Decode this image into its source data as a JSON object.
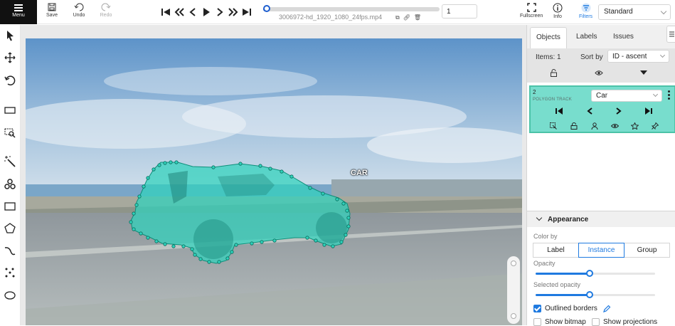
{
  "header": {
    "menu_label": "Menu",
    "save_label": "Save",
    "undo_label": "Undo",
    "redo_label": "Redo",
    "filename": "3006972-hd_1920_1080_24fps.mp4",
    "frame_number": "1",
    "playback_progress": 0.02,
    "fullscreen_label": "Fullscreen",
    "info_label": "Info",
    "filters_label": "Filters",
    "workspace_value": "Standard",
    "accent_color": "#1f7ae0"
  },
  "canvas": {
    "object_label_text": "CAR",
    "mask_color": "#2fd3bc"
  },
  "sidebar": {
    "tabs": [
      "Objects",
      "Labels",
      "Issues"
    ],
    "active_tab": "Objects",
    "items_count_text": "Items: 1",
    "sort_by_label": "Sort by",
    "sort_value": "ID - ascent",
    "object": {
      "id": "2",
      "type": "POLYGON TRACK",
      "label": "Car",
      "color": "#78ddcd"
    },
    "appearance": {
      "title": "Appearance",
      "color_by_label": "Color by",
      "color_by_options": [
        "Label",
        "Instance",
        "Group"
      ],
      "color_by_selected": "Instance",
      "opacity_label": "Opacity",
      "opacity_value": 0.45,
      "selected_opacity_label": "Selected opacity",
      "selected_opacity_value": 0.45,
      "outlined_borders_label": "Outlined borders",
      "outlined_borders_checked": true,
      "show_bitmap_label": "Show bitmap",
      "show_projections_label": "Show projections"
    }
  }
}
